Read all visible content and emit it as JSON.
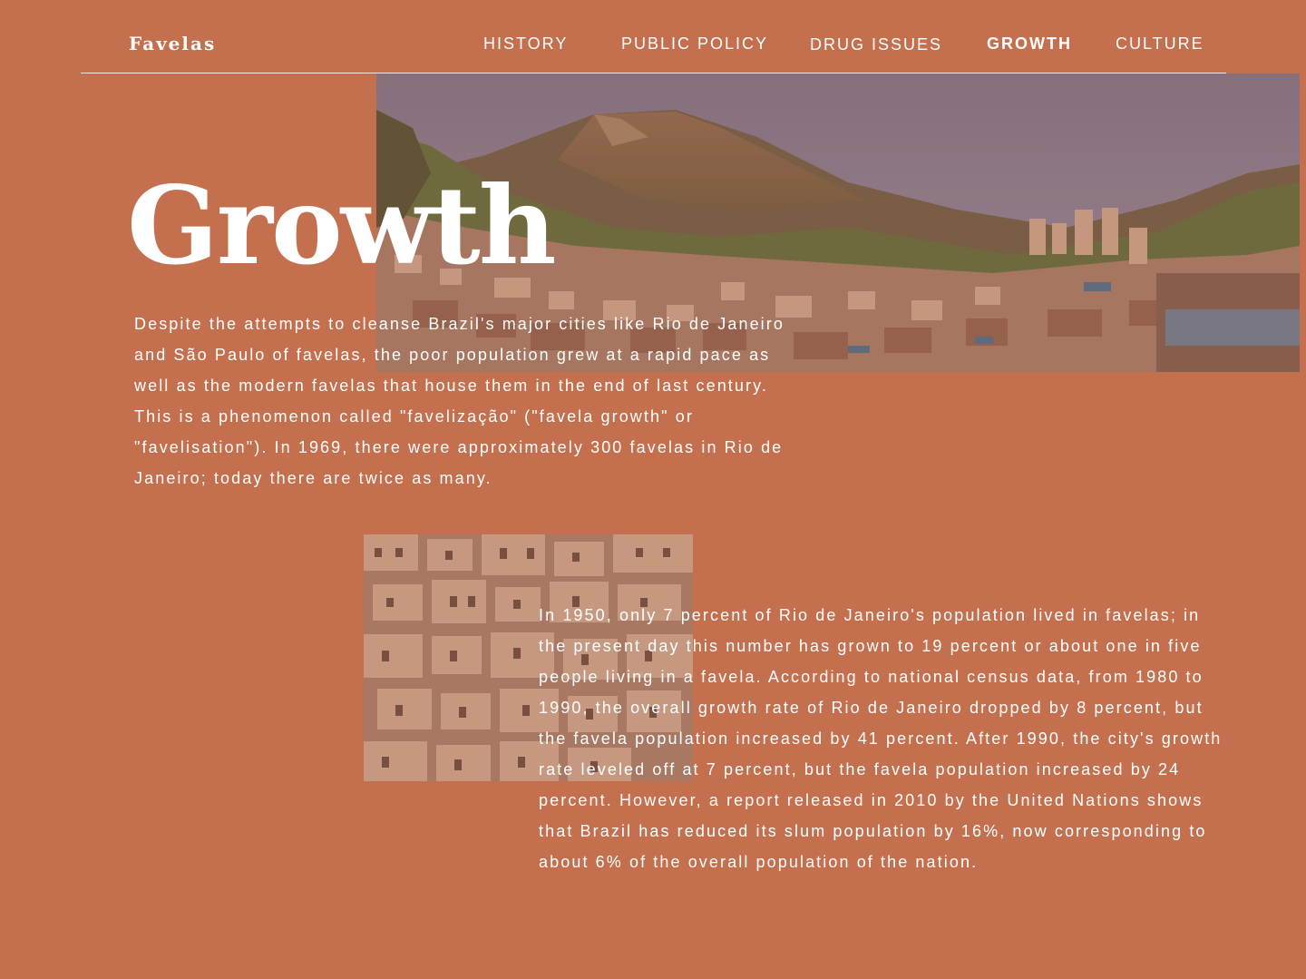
{
  "site": {
    "logo": "Favelas"
  },
  "nav": {
    "items": [
      {
        "label": "HISTORY"
      },
      {
        "label": "PUBLIC POLICY"
      },
      {
        "label": "DRUG ISSUES"
      },
      {
        "label": "GROWTH",
        "active": true
      },
      {
        "label": "CULTURE"
      }
    ]
  },
  "page": {
    "title": "Growth",
    "paragraph_1": "Despite the attempts to cleanse Brazil's major cities like Rio de Janeiro and São Paulo of favelas, the poor population grew at a rapid pace as well as the modern favelas that house them in the end of last century. This is a phenomenon called \"favelização\" (\"favela growth\" or \"favelisation\"). In 1969, there were approximately 300 favelas in Rio de Janeiro; today there are twice as many.",
    "paragraph_2": "In 1950, only 7 percent of Rio de Janeiro's population lived in favelas; in the present day this number has grown to 19 percent or about one in five people living in a favela. According to national census data, from 1980 to 1990, the overall growth rate of Rio de Janeiro dropped by 8 percent, but the favela population increased by 41 percent. After 1990, the city's growth rate leveled off at 7 percent, but the favela population increased by 24 percent. However, a report released in 2010 by the United Nations shows that Brazil has reduced its slum population by 16%, now corresponding to about 6% of the overall population of the nation."
  },
  "theme": {
    "background": "#c4704f",
    "text": "#ffffff"
  }
}
